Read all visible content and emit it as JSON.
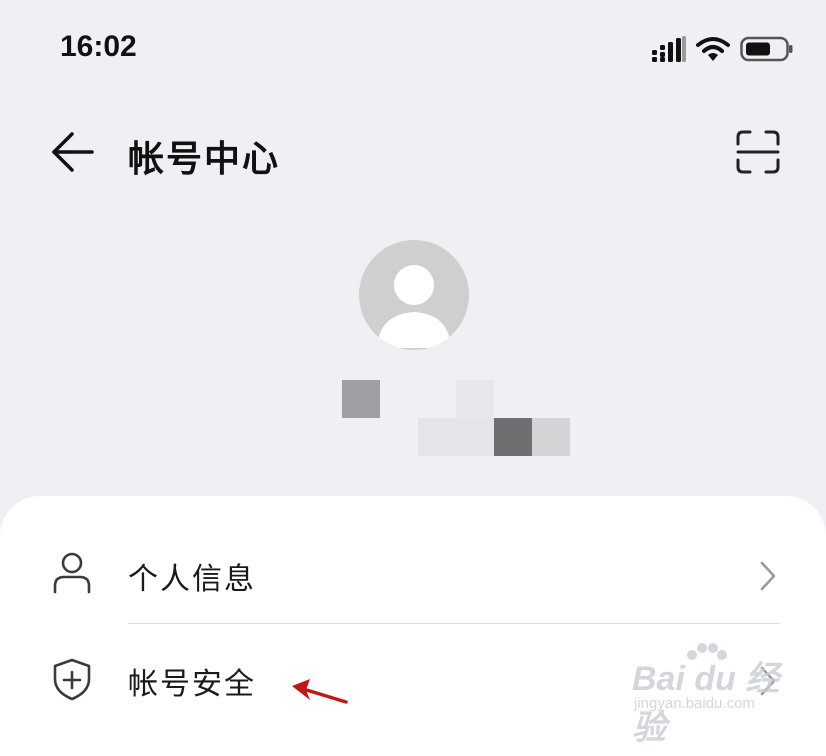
{
  "status_bar": {
    "time": "16:02",
    "icons": [
      "signal-icon",
      "wifi-icon",
      "battery-icon"
    ]
  },
  "header": {
    "title": "帐号中心",
    "back_icon": "back-arrow-icon",
    "scan_icon": "scan-icon"
  },
  "profile": {
    "avatar_icon": "default-avatar-icon"
  },
  "menu": {
    "items": [
      {
        "label": "个人信息",
        "icon": "person-icon"
      },
      {
        "label": "帐号安全",
        "icon": "shield-plus-icon"
      }
    ]
  },
  "watermark": {
    "main": "Bai du 经验",
    "sub": "jingyan.baidu.com"
  },
  "colors": {
    "page_bg": "#eef0f3",
    "card_bg": "#ffffff",
    "annotation_arrow": "#c0161c",
    "avatar_bg": "#cfcfcf"
  }
}
